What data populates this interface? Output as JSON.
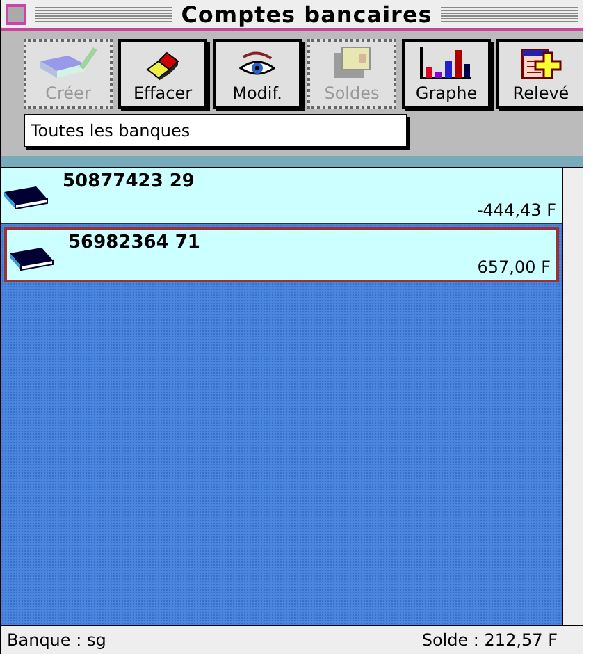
{
  "window": {
    "title": "Comptes bancaires"
  },
  "toolbar": [
    {
      "kind": "create",
      "label": "Créer",
      "disabled": true
    },
    {
      "kind": "erase",
      "label": "Effacer",
      "disabled": false
    },
    {
      "kind": "view",
      "label": "Modif.",
      "disabled": false
    },
    {
      "kind": "balance",
      "label": "Soldes",
      "disabled": true
    },
    {
      "kind": "chart",
      "label": "Graphe",
      "disabled": false
    },
    {
      "kind": "statement",
      "label": "Relevé",
      "disabled": false
    }
  ],
  "filter": {
    "value": "Toutes les banques"
  },
  "accounts": [
    {
      "number": "50877423 29",
      "balance": "-444,43 F",
      "selected": false
    },
    {
      "number": "56982364 71",
      "balance": "657,00 F",
      "selected": true
    }
  ],
  "status_bar": {
    "bank": "Banque : sg",
    "balance": "Solde : 212,57 F"
  }
}
